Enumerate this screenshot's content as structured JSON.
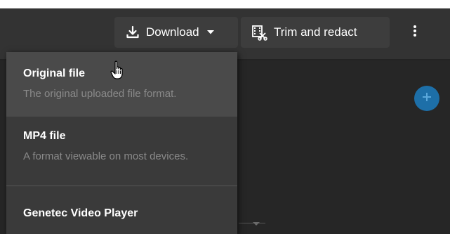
{
  "toolbar": {
    "download_label": "Download",
    "trim_label": "Trim and redact",
    "icons": {
      "download": "download-icon",
      "trim": "film-scissors-icon",
      "caret": "caret-down-icon",
      "more": "more-vertical-icon"
    }
  },
  "download_menu": {
    "items": [
      {
        "title": "Original file",
        "description": "The original uploaded file format."
      },
      {
        "title": "MP4 file",
        "description": "A format viewable on most devices."
      },
      {
        "title": "Genetec Video Player",
        "description": ""
      }
    ],
    "hovered_item": "Original file"
  },
  "add_button": {
    "icon": "plus-icon"
  },
  "colors": {
    "topbar": "#333333",
    "background": "#262626",
    "button": "#3d3d3d",
    "menu": "#3a3a3a",
    "menu_hover": "#4a4a4a",
    "accent": "#1d6fa8",
    "muted_text": "#8a8a8a"
  }
}
